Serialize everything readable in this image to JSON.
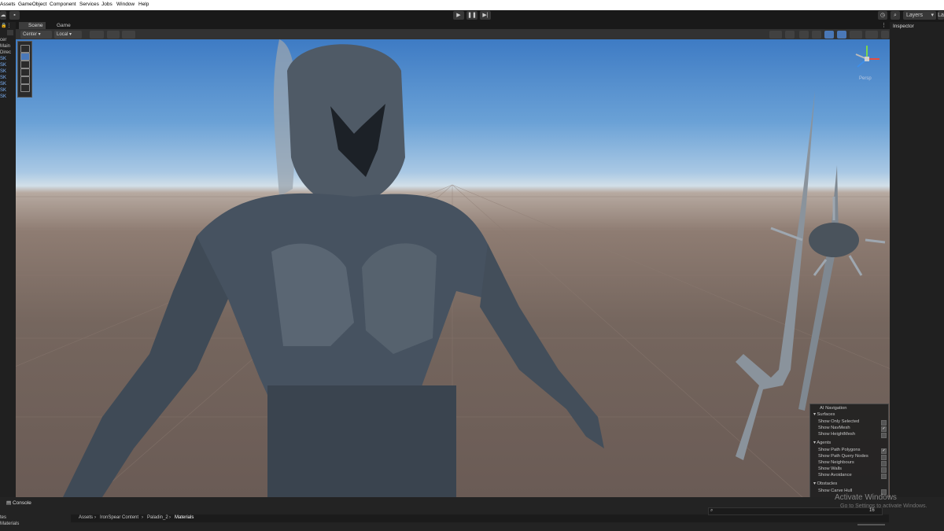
{
  "menu": {
    "items": [
      "Assets",
      "GameObject",
      "Component",
      "Services",
      "Jobs",
      "Window",
      "Help"
    ]
  },
  "toolbar": {
    "layers_label": "Layers",
    "layout_label": "La"
  },
  "hierarchy": {
    "items": [
      "cer",
      "Main",
      "Direc",
      "SK",
      "SK",
      "SK",
      "SK",
      "SK",
      "SK",
      "SK"
    ]
  },
  "scene_view": {
    "tabs": [
      "Scene",
      "Game"
    ],
    "pivot_label": "Center",
    "space_label": "Local",
    "gizmo_label": "Persp"
  },
  "inspector": {
    "tab_label": "Inspector"
  },
  "ai_navigation": {
    "title": "AI Navigation",
    "sections": [
      {
        "heading": "Surfaces",
        "items": [
          {
            "label": "Show Only Selected",
            "checked": false
          },
          {
            "label": "Show NavMesh",
            "checked": true
          },
          {
            "label": "Show HeightMesh",
            "checked": false
          }
        ]
      },
      {
        "heading": "Agents",
        "items": [
          {
            "label": "Show Path Polygons",
            "checked": true
          },
          {
            "label": "Show Path Query Nodes",
            "checked": false
          },
          {
            "label": "Show Neighbours",
            "checked": false
          },
          {
            "label": "Show Walls",
            "checked": false
          },
          {
            "label": "Show Avoidance",
            "checked": false
          }
        ]
      },
      {
        "heading": "Obstacles",
        "items": [
          {
            "label": "Show Carve Hull",
            "checked": false
          }
        ]
      }
    ]
  },
  "bottom": {
    "console_tab": "Console",
    "left_items": [
      "tes",
      "Materials"
    ],
    "breadcrumb": [
      "Assets",
      "IronSpear Content",
      "Paladin_2",
      "Materials"
    ],
    "count_label": "16"
  },
  "watermark": {
    "line1": "Activate Windows",
    "line2": "Go to Settings to activate Windows."
  },
  "colors": {
    "sky_top": "#3e7bc4",
    "ground": "#75665e",
    "armor": "#4d5866",
    "editor_bg": "#191919"
  }
}
